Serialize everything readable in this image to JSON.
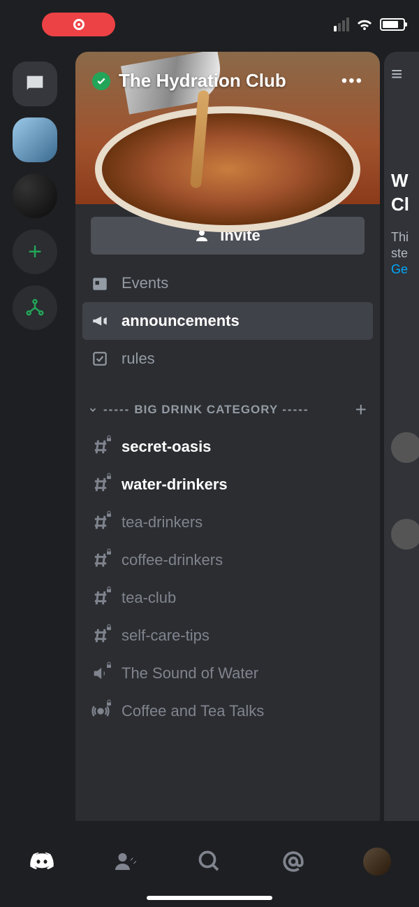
{
  "server": {
    "name": "The Hydration Club",
    "invite_label": "Invite"
  },
  "nav": {
    "events": "Events",
    "announcements": "announcements",
    "rules": "rules"
  },
  "category": {
    "name": "BIG DRINK CATEGORY",
    "dashes": "-----"
  },
  "channels": [
    {
      "name": "secret-oasis",
      "type": "text-locked",
      "unread": true
    },
    {
      "name": "water-drinkers",
      "type": "text-locked",
      "unread": true
    },
    {
      "name": "tea-drinkers",
      "type": "text-locked",
      "unread": false
    },
    {
      "name": "coffee-drinkers",
      "type": "text-locked",
      "unread": false
    },
    {
      "name": "tea-club",
      "type": "text-locked",
      "unread": false
    },
    {
      "name": "self-care-tips",
      "type": "text-locked",
      "unread": false
    },
    {
      "name": "The Sound of Water",
      "type": "voice-locked",
      "unread": false
    },
    {
      "name": "Coffee and Tea Talks",
      "type": "stage-locked",
      "unread": false
    }
  ],
  "peek": {
    "title_line1": "W",
    "title_line2": "Cl",
    "sub_line1": "Thi",
    "sub_line2": "ste",
    "link": "Ge"
  }
}
